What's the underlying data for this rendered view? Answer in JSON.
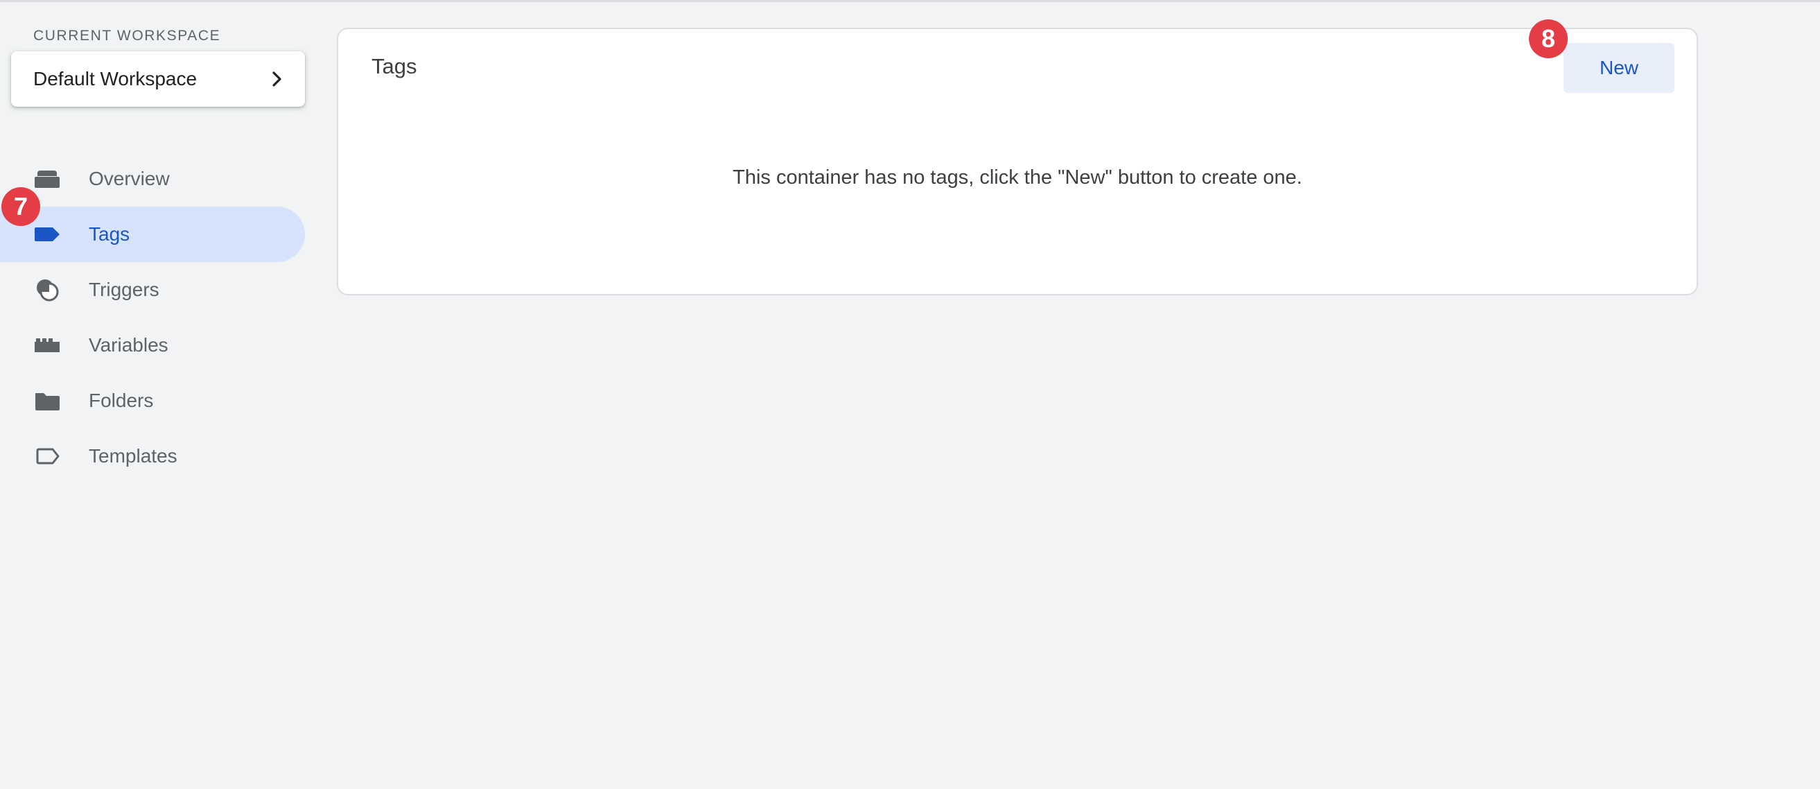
{
  "workspace": {
    "section_label": "CURRENT WORKSPACE",
    "name": "Default Workspace"
  },
  "sidebar": {
    "items": [
      {
        "label": "Overview",
        "icon": "overview-icon",
        "active": false
      },
      {
        "label": "Tags",
        "icon": "tag-icon",
        "active": true
      },
      {
        "label": "Triggers",
        "icon": "trigger-icon",
        "active": false
      },
      {
        "label": "Variables",
        "icon": "variables-icon",
        "active": false
      },
      {
        "label": "Folders",
        "icon": "folder-icon",
        "active": false
      },
      {
        "label": "Templates",
        "icon": "template-icon",
        "active": false
      }
    ]
  },
  "main": {
    "title": "Tags",
    "new_button_label": "New",
    "empty_message": "This container has no tags, click the \"New\" button to create one."
  },
  "badges": {
    "sidebar_badge": "7",
    "new_button_badge": "8"
  },
  "colors": {
    "accent": "#1a56c4",
    "active_bg": "#d7e3fa",
    "badge": "#e53d45",
    "page_bg": "#f1f3f4"
  }
}
